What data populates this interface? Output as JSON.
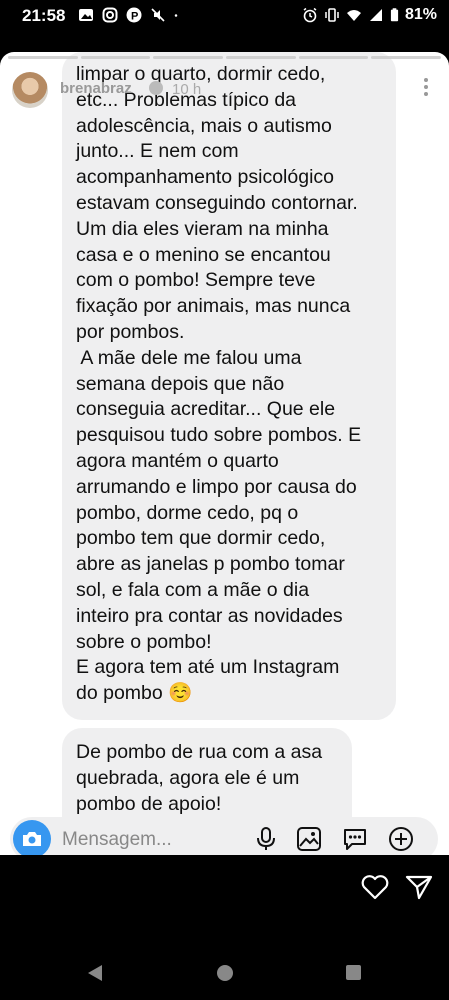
{
  "status_bar": {
    "time": "21:58",
    "battery": "81%",
    "left_icons": [
      "gallery-icon",
      "instagram-icon",
      "p-app-icon",
      "mute-icon",
      "dot-icon"
    ],
    "right_icons": [
      "alarm-icon",
      "vibrate-icon",
      "wifi-icon",
      "signal-icon",
      "battery-icon"
    ]
  },
  "story": {
    "username": "brenabraz",
    "time_ago": "10 h"
  },
  "messages": [
    {
      "lines": [
        "limpar o quarto, dormir cedo,",
        "etc... Problemas típico da",
        "adolescência, mais o autismo",
        "junto... E nem com",
        "acompanhamento psicológico",
        "estavam conseguindo contornar.",
        "Um dia eles vieram na minha",
        "casa e o menino se encantou",
        "com o pombo! Sempre teve",
        "fixação por animais, mas nunca",
        "por pombos.",
        " A mãe dele me falou uma",
        "semana depois que não",
        "conseguia acreditar... Que ele",
        "pesquisou tudo sobre pombos. E",
        "agora mantém o quarto",
        "arrumando e limpo por causa do",
        "pombo, dorme cedo, pq o",
        "pombo tem que dormir cedo,",
        "abre as janelas p pombo tomar",
        "sol, e fala com a mãe o dia",
        "inteiro pra contar as novidades",
        "sobre o pombo!",
        "E agora tem até um Instagram",
        "do pombo ☺️"
      ]
    },
    {
      "lines": [
        "De pombo de rua com a asa",
        "quebrada, agora ele é um",
        "pombo de apoio!"
      ]
    }
  ],
  "composer": {
    "placeholder": "Mensagem..."
  },
  "colors": {
    "accent": "#3797f0",
    "bubble": "#efeff0"
  }
}
